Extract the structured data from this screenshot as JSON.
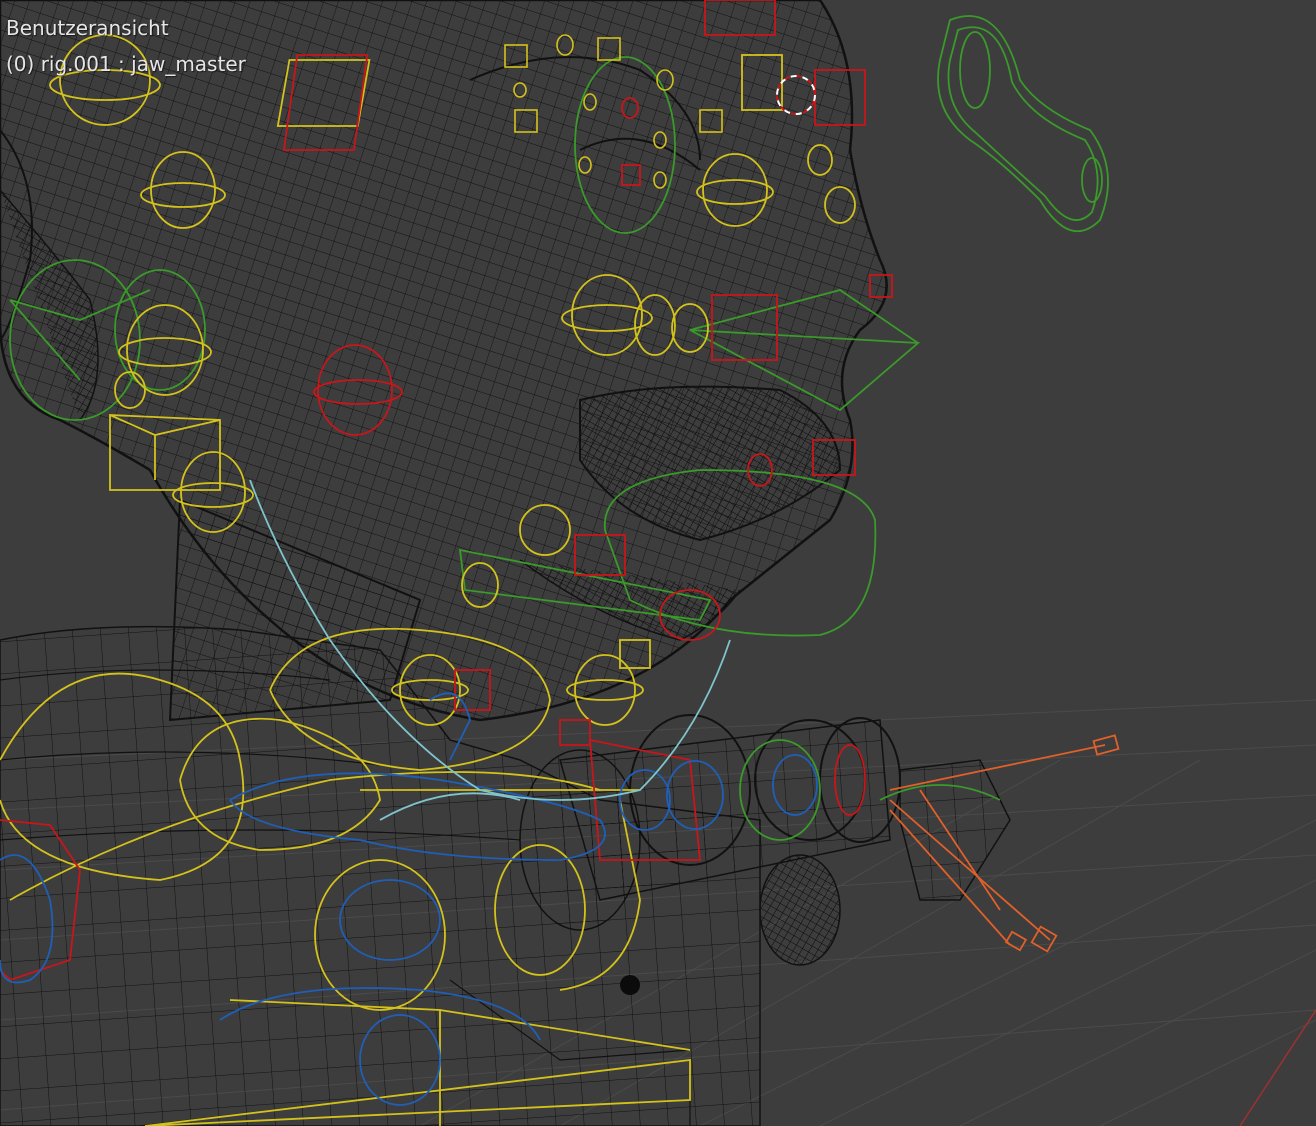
{
  "viewport": {
    "view_name": "Benutzeransicht",
    "active_object": "(0) rig.001 : jaw_master"
  },
  "colors": {
    "background": "#3d3d3d",
    "grid": "#4a4a4a",
    "mesh_wire": "#111111",
    "bone_yellow": "#d4c21c",
    "bone_red": "#c8161a",
    "bone_green": "#3a9a2a",
    "bone_blue": "#1f5fb8",
    "bone_cyan": "#7fc4cc",
    "bone_orange": "#e0602a",
    "axis_red": "#a03030",
    "cursor": "#ffffff"
  },
  "icons": {
    "cursor": "3d-cursor-icon"
  }
}
